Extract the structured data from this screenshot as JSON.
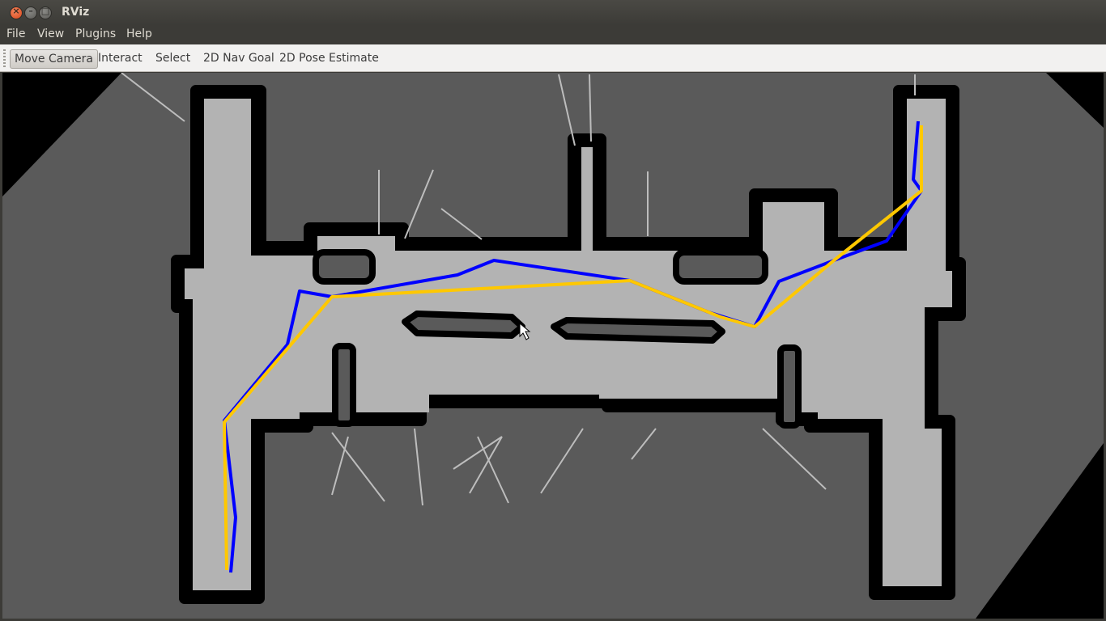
{
  "window": {
    "title": "RViz",
    "buttons": {
      "close": "×",
      "minimize": "–",
      "maximize": "□"
    }
  },
  "menu": [
    "File",
    "View",
    "Plugins",
    "Help"
  ],
  "toolbar": {
    "tools": [
      "Move Camera",
      "Interact",
      "Select",
      "2D Nav Goal",
      "2D Pose Estimate"
    ],
    "active": "Move Camera"
  },
  "map": {
    "background_color": "#000000",
    "unknown_color": "#5a5a5a",
    "free_color": "#b3b3b3",
    "occupied_color": "#000000",
    "global_path_color": "#0000ff",
    "local_path_color": "#ffc800"
  }
}
